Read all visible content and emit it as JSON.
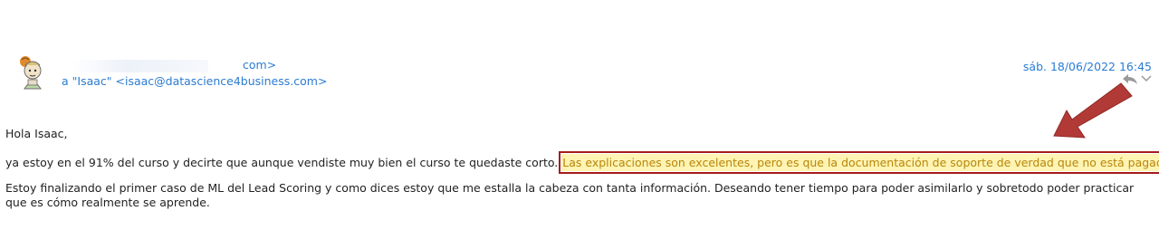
{
  "email": {
    "from_domain_suffix": "com>",
    "to_line": "a \"Isaac\" <isaac@datascience4business.com>",
    "date": "sáb. 18/06/2022 16:45",
    "greeting": "Hola Isaac,",
    "paragraph1_start": "ya estoy en el 91% del curso y decirte que aunque vendiste muy bien el curso te quedaste corto.",
    "paragraph1_highlight": "Las explicaciones son excelentes, pero es que la documentación de soporte de verdad que no está pagada.",
    "paragraph2": "Estoy finalizando el primer caso de ML del Lead Scoring y como dices estoy que me estalla la cabeza con tanta información. Deseando tener tiempo para poder asimilarlo y sobretodo poder practicar que es cómo realmente se aprende."
  },
  "icons": {
    "avatar": "cartoon-avatar-icon",
    "reply": "reply-arrow-icon",
    "more": "chevron-down-icon",
    "annotation": "red-arrow-annotation"
  },
  "colors": {
    "link": "#2b7cd3",
    "highlight_bg": "#fff4b3",
    "highlight_text": "#b8860b",
    "highlight_border": "#a51c1c",
    "arrow": "#b23a36"
  }
}
